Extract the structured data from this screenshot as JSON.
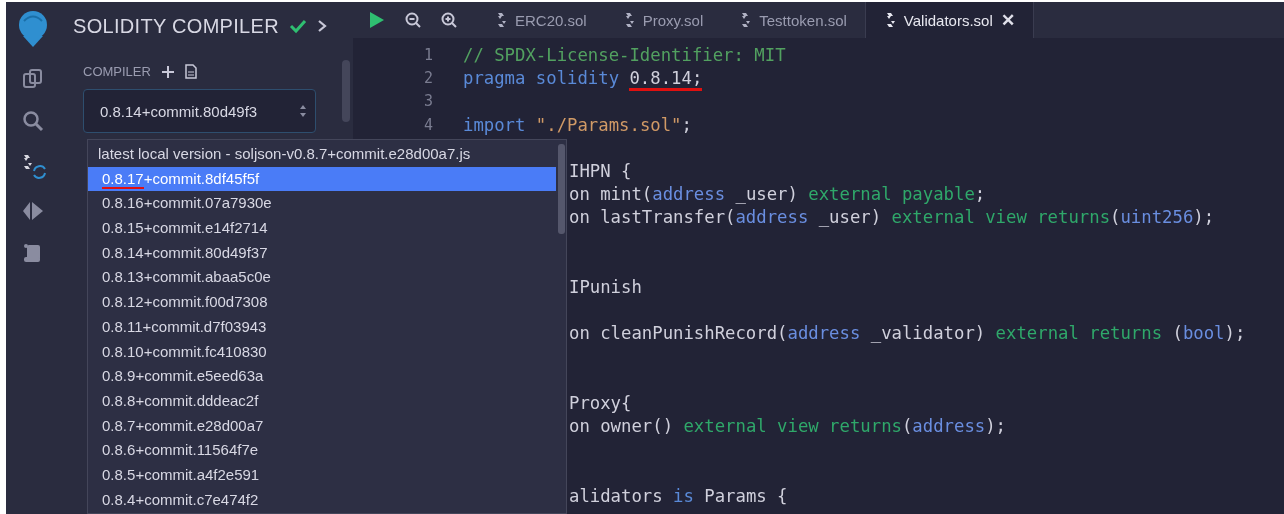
{
  "sidebar": {
    "title": "SOLIDITY COMPILER",
    "compiled": true,
    "compiler_label": "COMPILER",
    "version_field": {
      "value": "0.8.14+commit.80d49f3"
    }
  },
  "toolbar_tabs": [
    {
      "label": "ERC20.sol",
      "selected": false
    },
    {
      "label": "Proxy.sol",
      "selected": false
    },
    {
      "label": "Testtoken.sol",
      "selected": false
    },
    {
      "label": "Validators.sol",
      "selected": true
    }
  ],
  "close_glyph": "✕",
  "line_numbers": [
    "1",
    "2",
    "3",
    "4"
  ],
  "code_lines": [
    {
      "kind": "code",
      "tokens": [
        {
          "kind": "comment",
          "text": "// SPDX-License-Identifier: MIT"
        }
      ]
    },
    {
      "kind": "code",
      "tokens": [
        {
          "kind": "keyword",
          "text": "pragma solidity "
        },
        {
          "kind": "plain",
          "text": "0.8.14;",
          "marked": true
        }
      ]
    },
    {
      "kind": "blank"
    },
    {
      "kind": "code",
      "tokens": [
        {
          "kind": "keyword",
          "text": "import "
        },
        {
          "kind": "string",
          "text": "\"./Params.sol\""
        },
        {
          "kind": "plain",
          "text": ";"
        }
      ]
    },
    {
      "kind": "blank"
    },
    {
      "kind": "code",
      "tokens": [
        {
          "kind": "plain",
          "text": "IHPN {"
        }
      ]
    },
    {
      "kind": "code",
      "tokens": [
        {
          "kind": "plain",
          "text": "on mint("
        },
        {
          "kind": "type",
          "text": "address"
        },
        {
          "kind": "plain",
          "text": " _user) "
        },
        {
          "kind": "modifier",
          "text": "external payable"
        },
        {
          "kind": "plain",
          "text": ";"
        }
      ]
    },
    {
      "kind": "code",
      "tokens": [
        {
          "kind": "plain",
          "text": "on lastTransfer("
        },
        {
          "kind": "type",
          "text": "address"
        },
        {
          "kind": "plain",
          "text": " _user) "
        },
        {
          "kind": "modifier",
          "text": "external view returns"
        },
        {
          "kind": "plain",
          "text": "("
        },
        {
          "kind": "type",
          "text": "uint256"
        },
        {
          "kind": "plain",
          "text": ");"
        }
      ]
    },
    {
      "kind": "blank"
    },
    {
      "kind": "blank"
    },
    {
      "kind": "code",
      "tokens": [
        {
          "kind": "plain",
          "text": "IPunish"
        }
      ]
    },
    {
      "kind": "blank"
    },
    {
      "kind": "code",
      "tokens": [
        {
          "kind": "plain",
          "text": "on cleanPunishRecord("
        },
        {
          "kind": "type",
          "text": "address"
        },
        {
          "kind": "plain",
          "text": " _validator) "
        },
        {
          "kind": "modifier",
          "text": "external returns"
        },
        {
          "kind": "plain",
          "text": " ("
        },
        {
          "kind": "type",
          "text": "bool"
        },
        {
          "kind": "plain",
          "text": ");"
        }
      ]
    },
    {
      "kind": "blank"
    },
    {
      "kind": "blank"
    },
    {
      "kind": "code",
      "tokens": [
        {
          "kind": "plain",
          "text": "Proxy{"
        }
      ]
    },
    {
      "kind": "code",
      "tokens": [
        {
          "kind": "plain",
          "text": "on owner() "
        },
        {
          "kind": "modifier",
          "text": "external view returns"
        },
        {
          "kind": "plain",
          "text": "("
        },
        {
          "kind": "type",
          "text": "address"
        },
        {
          "kind": "plain",
          "text": ");"
        }
      ]
    },
    {
      "kind": "blank"
    },
    {
      "kind": "blank"
    },
    {
      "kind": "code",
      "tokens": [
        {
          "kind": "plain",
          "text": "alidators "
        },
        {
          "kind": "keyword",
          "text": "is"
        },
        {
          "kind": "plain",
          "text": " Params {"
        }
      ]
    }
  ],
  "version_dropdown": [
    {
      "kind": "local",
      "label": "latest local version - soljson-v0.8.7+commit.e28d00a7.js",
      "selected": false
    },
    {
      "kind": "release",
      "version": "0.8.17",
      "build": "+commit.8df45f5f",
      "selected": true,
      "marked": true
    },
    {
      "kind": "release",
      "version": "0.8.16",
      "build": "+commit.07a7930e",
      "selected": false
    },
    {
      "kind": "release",
      "version": "0.8.15",
      "build": "+commit.e14f2714",
      "selected": false
    },
    {
      "kind": "release",
      "version": "0.8.14",
      "build": "+commit.80d49f37",
      "selected": false
    },
    {
      "kind": "release",
      "version": "0.8.13",
      "build": "+commit.abaa5c0e",
      "selected": false
    },
    {
      "kind": "release",
      "version": "0.8.12",
      "build": "+commit.f00d7308",
      "selected": false
    },
    {
      "kind": "release",
      "version": "0.8.11",
      "build": "+commit.d7f03943",
      "selected": false
    },
    {
      "kind": "release",
      "version": "0.8.10",
      "build": "+commit.fc410830",
      "selected": false
    },
    {
      "kind": "release",
      "version": "0.8.9",
      "build": "+commit.e5eed63a",
      "selected": false
    },
    {
      "kind": "release",
      "version": "0.8.8",
      "build": "+commit.dddeac2f",
      "selected": false
    },
    {
      "kind": "release",
      "version": "0.8.7",
      "build": "+commit.e28d00a7",
      "selected": false
    },
    {
      "kind": "release",
      "version": "0.8.6",
      "build": "+commit.11564f7e",
      "selected": false
    },
    {
      "kind": "release",
      "version": "0.8.5",
      "build": "+commit.a4f2e591",
      "selected": false
    },
    {
      "kind": "release",
      "version": "0.8.4",
      "build": "+commit.c7e474f2",
      "selected": false
    }
  ]
}
